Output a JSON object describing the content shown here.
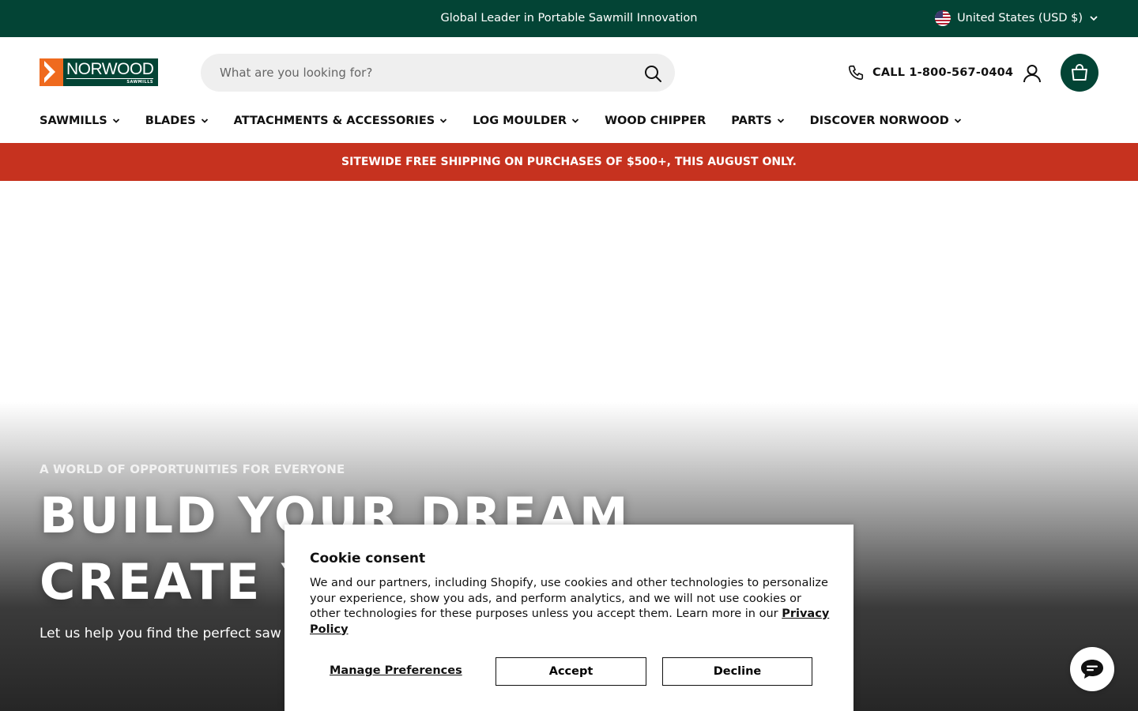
{
  "topbar": {
    "message": "Global Leader in Portable Sawmill Innovation",
    "country": "United States (USD $)",
    "flag_icon": "us-flag-icon"
  },
  "brand": {
    "logo_text": "NORWOOD",
    "logo_subtext": "SAWMILLS",
    "primary_color": "#034435",
    "accent_color": "#ef6a1e"
  },
  "header": {
    "search_placeholder": "What are you looking for?",
    "phone_label": "CALL 1-800-567-0404",
    "icons": {
      "search": "search-icon",
      "phone": "phone-icon",
      "account": "user-icon",
      "cart": "shopping-bag-icon"
    }
  },
  "nav": {
    "items": [
      {
        "label": "SAWMILLS",
        "has_dropdown": true
      },
      {
        "label": "BLADES",
        "has_dropdown": true
      },
      {
        "label": "ATTACHMENTS & ACCESSORIES",
        "has_dropdown": true
      },
      {
        "label": "LOG MOULDER",
        "has_dropdown": true
      },
      {
        "label": "WOOD CHIPPER",
        "has_dropdown": false
      },
      {
        "label": "PARTS",
        "has_dropdown": true
      },
      {
        "label": "DISCOVER NORWOOD",
        "has_dropdown": true
      }
    ]
  },
  "promo": {
    "text": "SITEWIDE FREE SHIPPING ON PURCHASES OF $500+, THIS AUGUST ONLY.",
    "color": "#c6321f"
  },
  "hero": {
    "eyebrow": "A WORLD OF OPPORTUNITIES FOR EVERYONE",
    "headline_line1": "BUILD YOUR DREAM",
    "headline_line2": "CREATE YO",
    "subtext": "Let us help you find the perfect saw"
  },
  "cookie": {
    "title": "Cookie consent",
    "body": "We and our partners, including Shopify, use cookies and other technologies to personalize your experience, show you ads, and perform analytics, and we will not use cookies or other technologies for these purposes unless you accept them. Learn more in our",
    "link": "Privacy Policy",
    "manage": "Manage Preferences",
    "accept": "Accept",
    "decline": "Decline"
  },
  "chat": {
    "icon": "chat-bubble-icon"
  }
}
